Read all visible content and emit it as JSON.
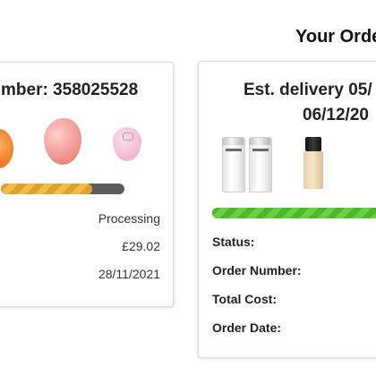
{
  "header": {
    "title": "Your Orde"
  },
  "orders": [
    {
      "heading": "mber: 358025528",
      "products": [
        "orange-sponge",
        "pink-sponge",
        "light-pink-sponge"
      ],
      "progress": 0.74,
      "progress_color": "#e0a12a",
      "status": "Processing",
      "total_cost": "£29.02",
      "order_date": "28/11/2021"
    },
    {
      "delivery_line1": "Est. delivery 05/",
      "delivery_line2": "06/12/20",
      "products": [
        "shampoo-bottle",
        "shampoo-bottle",
        "foundation-bottle"
      ],
      "progress": 1.0,
      "progress_color": "#4db82d",
      "labels": {
        "status": "Status:",
        "order_number": "Order Number:",
        "total_cost": "Total Cost:",
        "order_date": "Order Date:"
      }
    }
  ]
}
